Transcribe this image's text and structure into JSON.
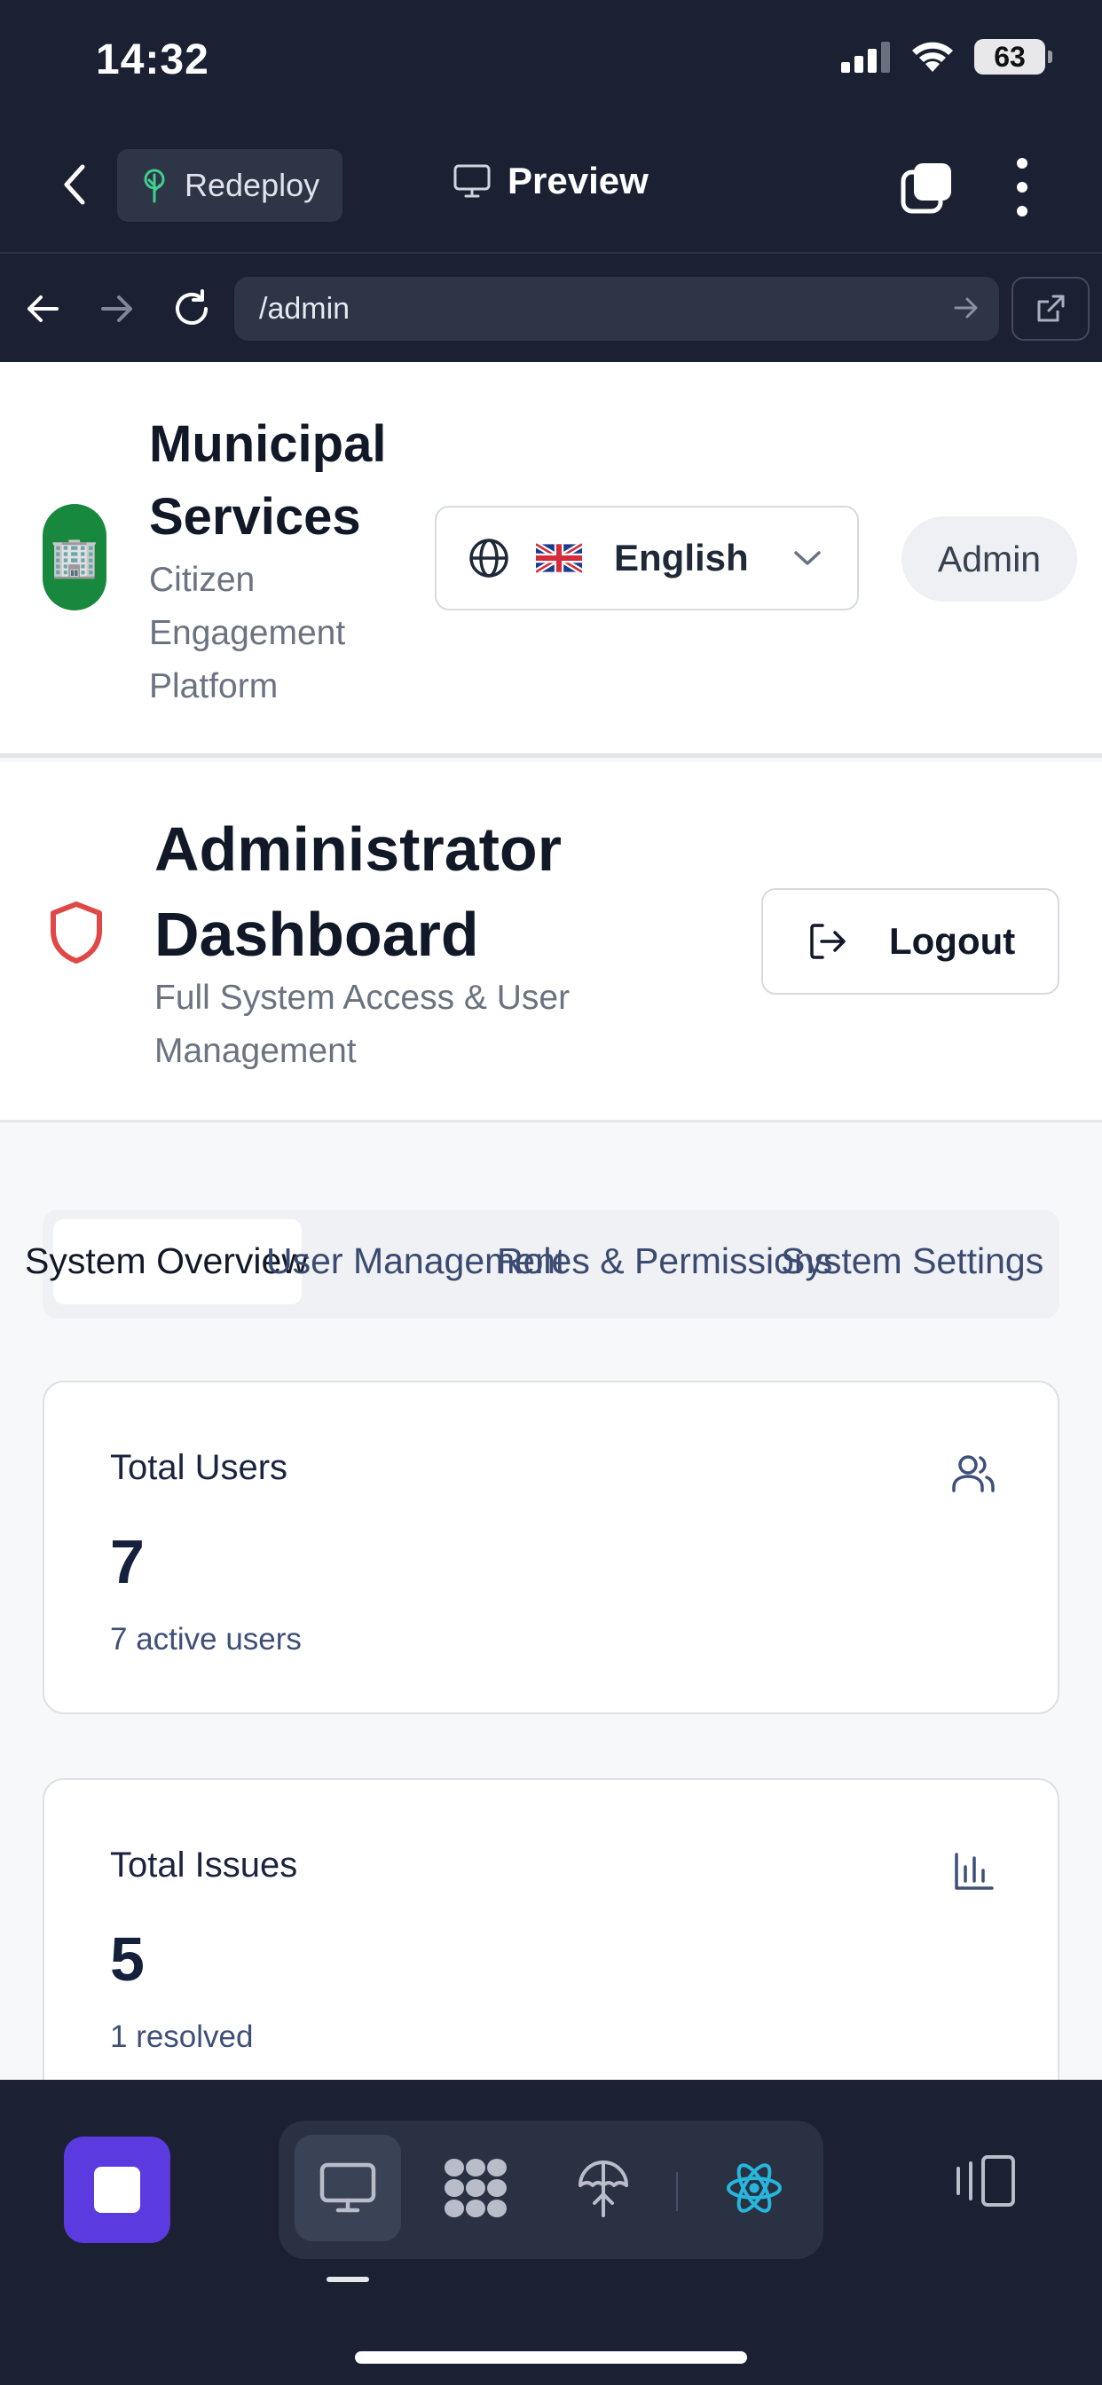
{
  "status_bar": {
    "time": "14:32",
    "battery": "63"
  },
  "app_bar": {
    "redeploy_label": "Redeploy",
    "preview_label": "Preview"
  },
  "browser": {
    "url": "/admin"
  },
  "site": {
    "title": "Municipal Services",
    "subtitle": "Citizen Engagement Platform",
    "logo_icon": "🏢",
    "language": "English",
    "role_badge": "Admin"
  },
  "dashboard": {
    "title": "Administrator Dashboard",
    "subtitle": "Full System Access & User Management",
    "logout_label": "Logout",
    "accent_color": "#e04848"
  },
  "tabs": [
    {
      "label": "System Overview",
      "active": true
    },
    {
      "label": "User Management",
      "active": false
    },
    {
      "label": "Roles & Permissions",
      "active": false
    },
    {
      "label": "System Settings",
      "active": false
    }
  ],
  "stats": [
    {
      "label": "Total Users",
      "value": "7",
      "note": "7 active users",
      "icon": "users-icon"
    },
    {
      "label": "Total Issues",
      "value": "5",
      "note": "1 resolved",
      "icon": "bar-chart-icon"
    }
  ],
  "toolbar": {
    "stop_color": "#5b3be0",
    "tools": [
      "monitor-icon",
      "grid-icon",
      "deploy-icon",
      "react-icon"
    ]
  }
}
